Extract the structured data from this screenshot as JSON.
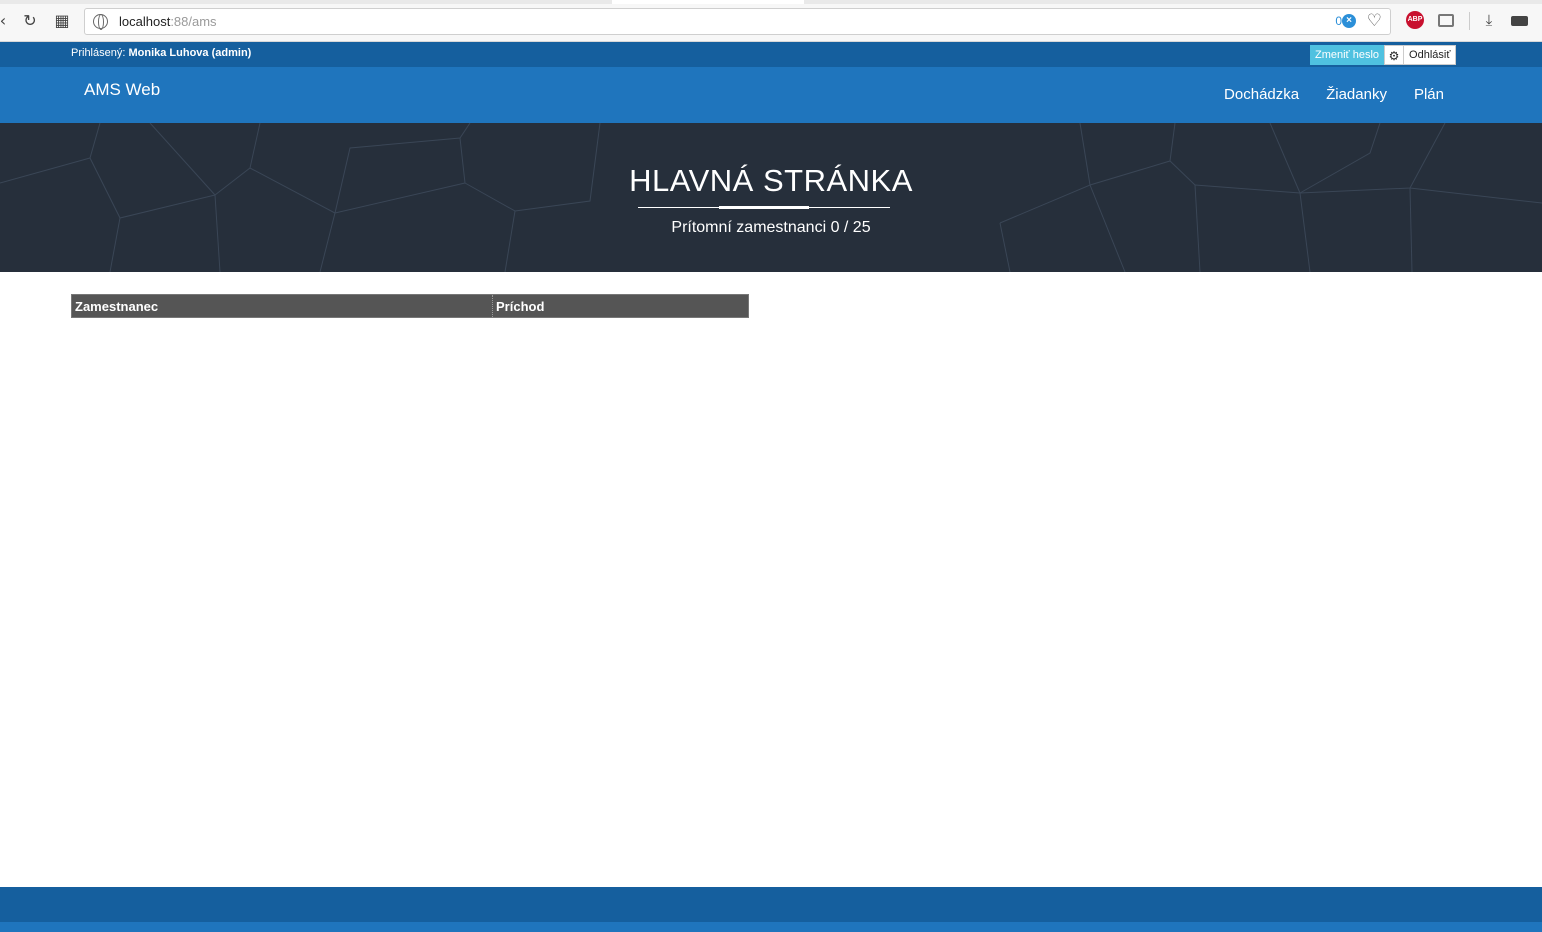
{
  "browser": {
    "url_host": "localhost",
    "url_path": ":88/ams",
    "blocked_count": "0",
    "back_icon": "back-icon",
    "reload_icon": "reload-icon",
    "speed_dial_icon": "grid-icon",
    "abp_label": "ABP"
  },
  "user_bar": {
    "logged_label": "Prihlásený:",
    "user_name": "Monika Luhova (admin)",
    "change_password": "Zmeniť heslo",
    "logout": "Odhlásiť"
  },
  "navbar": {
    "brand": "AMS Web",
    "links": [
      "Dochádzka",
      "Žiadanky",
      "Plán"
    ]
  },
  "hero": {
    "title": "HLAVNÁ STRÁNKA",
    "subtitle": "Prítomní zamestnanci 0 / 25"
  },
  "table": {
    "headers": [
      "Zamestnanec",
      "Príchod"
    ]
  },
  "colors": {
    "navbar": "#1f75bd",
    "user_bar": "#155f9e",
    "hero": "#262f3b",
    "accent_button": "#4fc1e0"
  }
}
